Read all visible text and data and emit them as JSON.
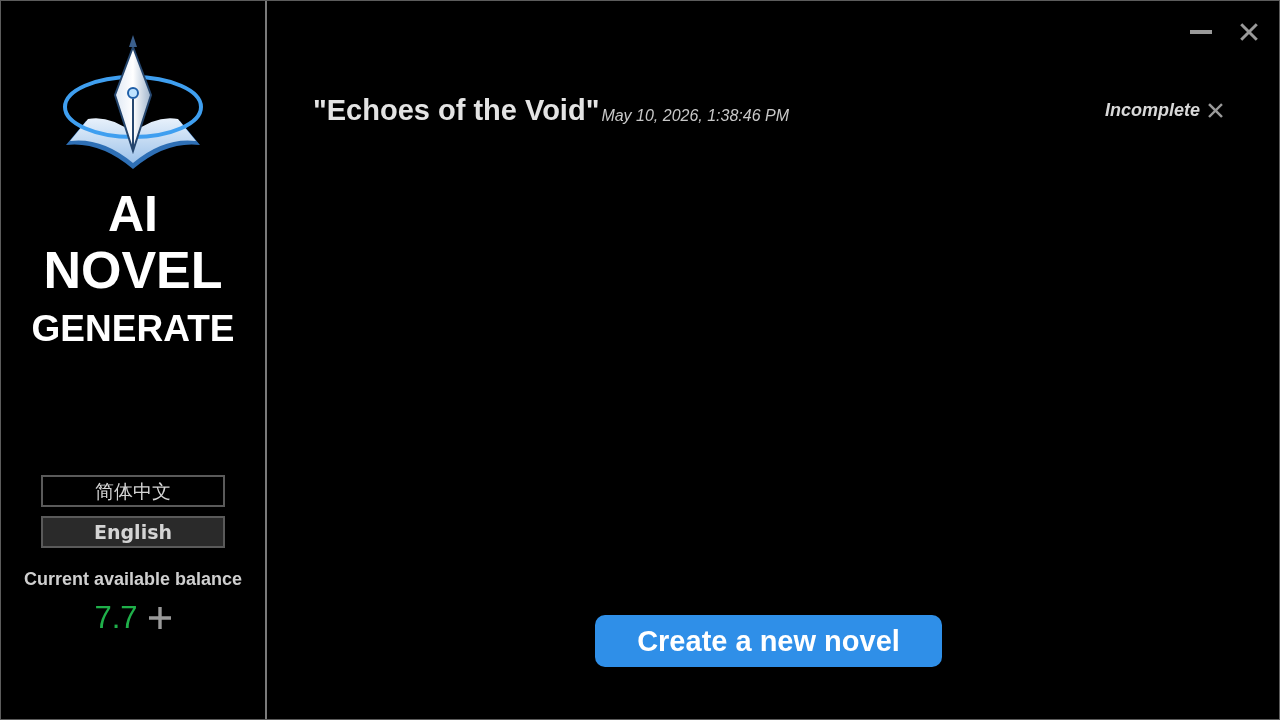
{
  "sidebar": {
    "app_title": [
      "AI",
      "NOVEL",
      "GENERATE"
    ],
    "languages": [
      {
        "label": "简体中文",
        "selected": false
      },
      {
        "label": "English",
        "selected": true
      }
    ],
    "balance": {
      "label": "Current available balance",
      "amount": "7.7"
    }
  },
  "novels": [
    {
      "title": "\"Echoes of the Void\"",
      "date": "May 10, 2026, 1:38:46 PM",
      "status": "Incomplete"
    }
  ],
  "create_button": "Create a new novel"
}
